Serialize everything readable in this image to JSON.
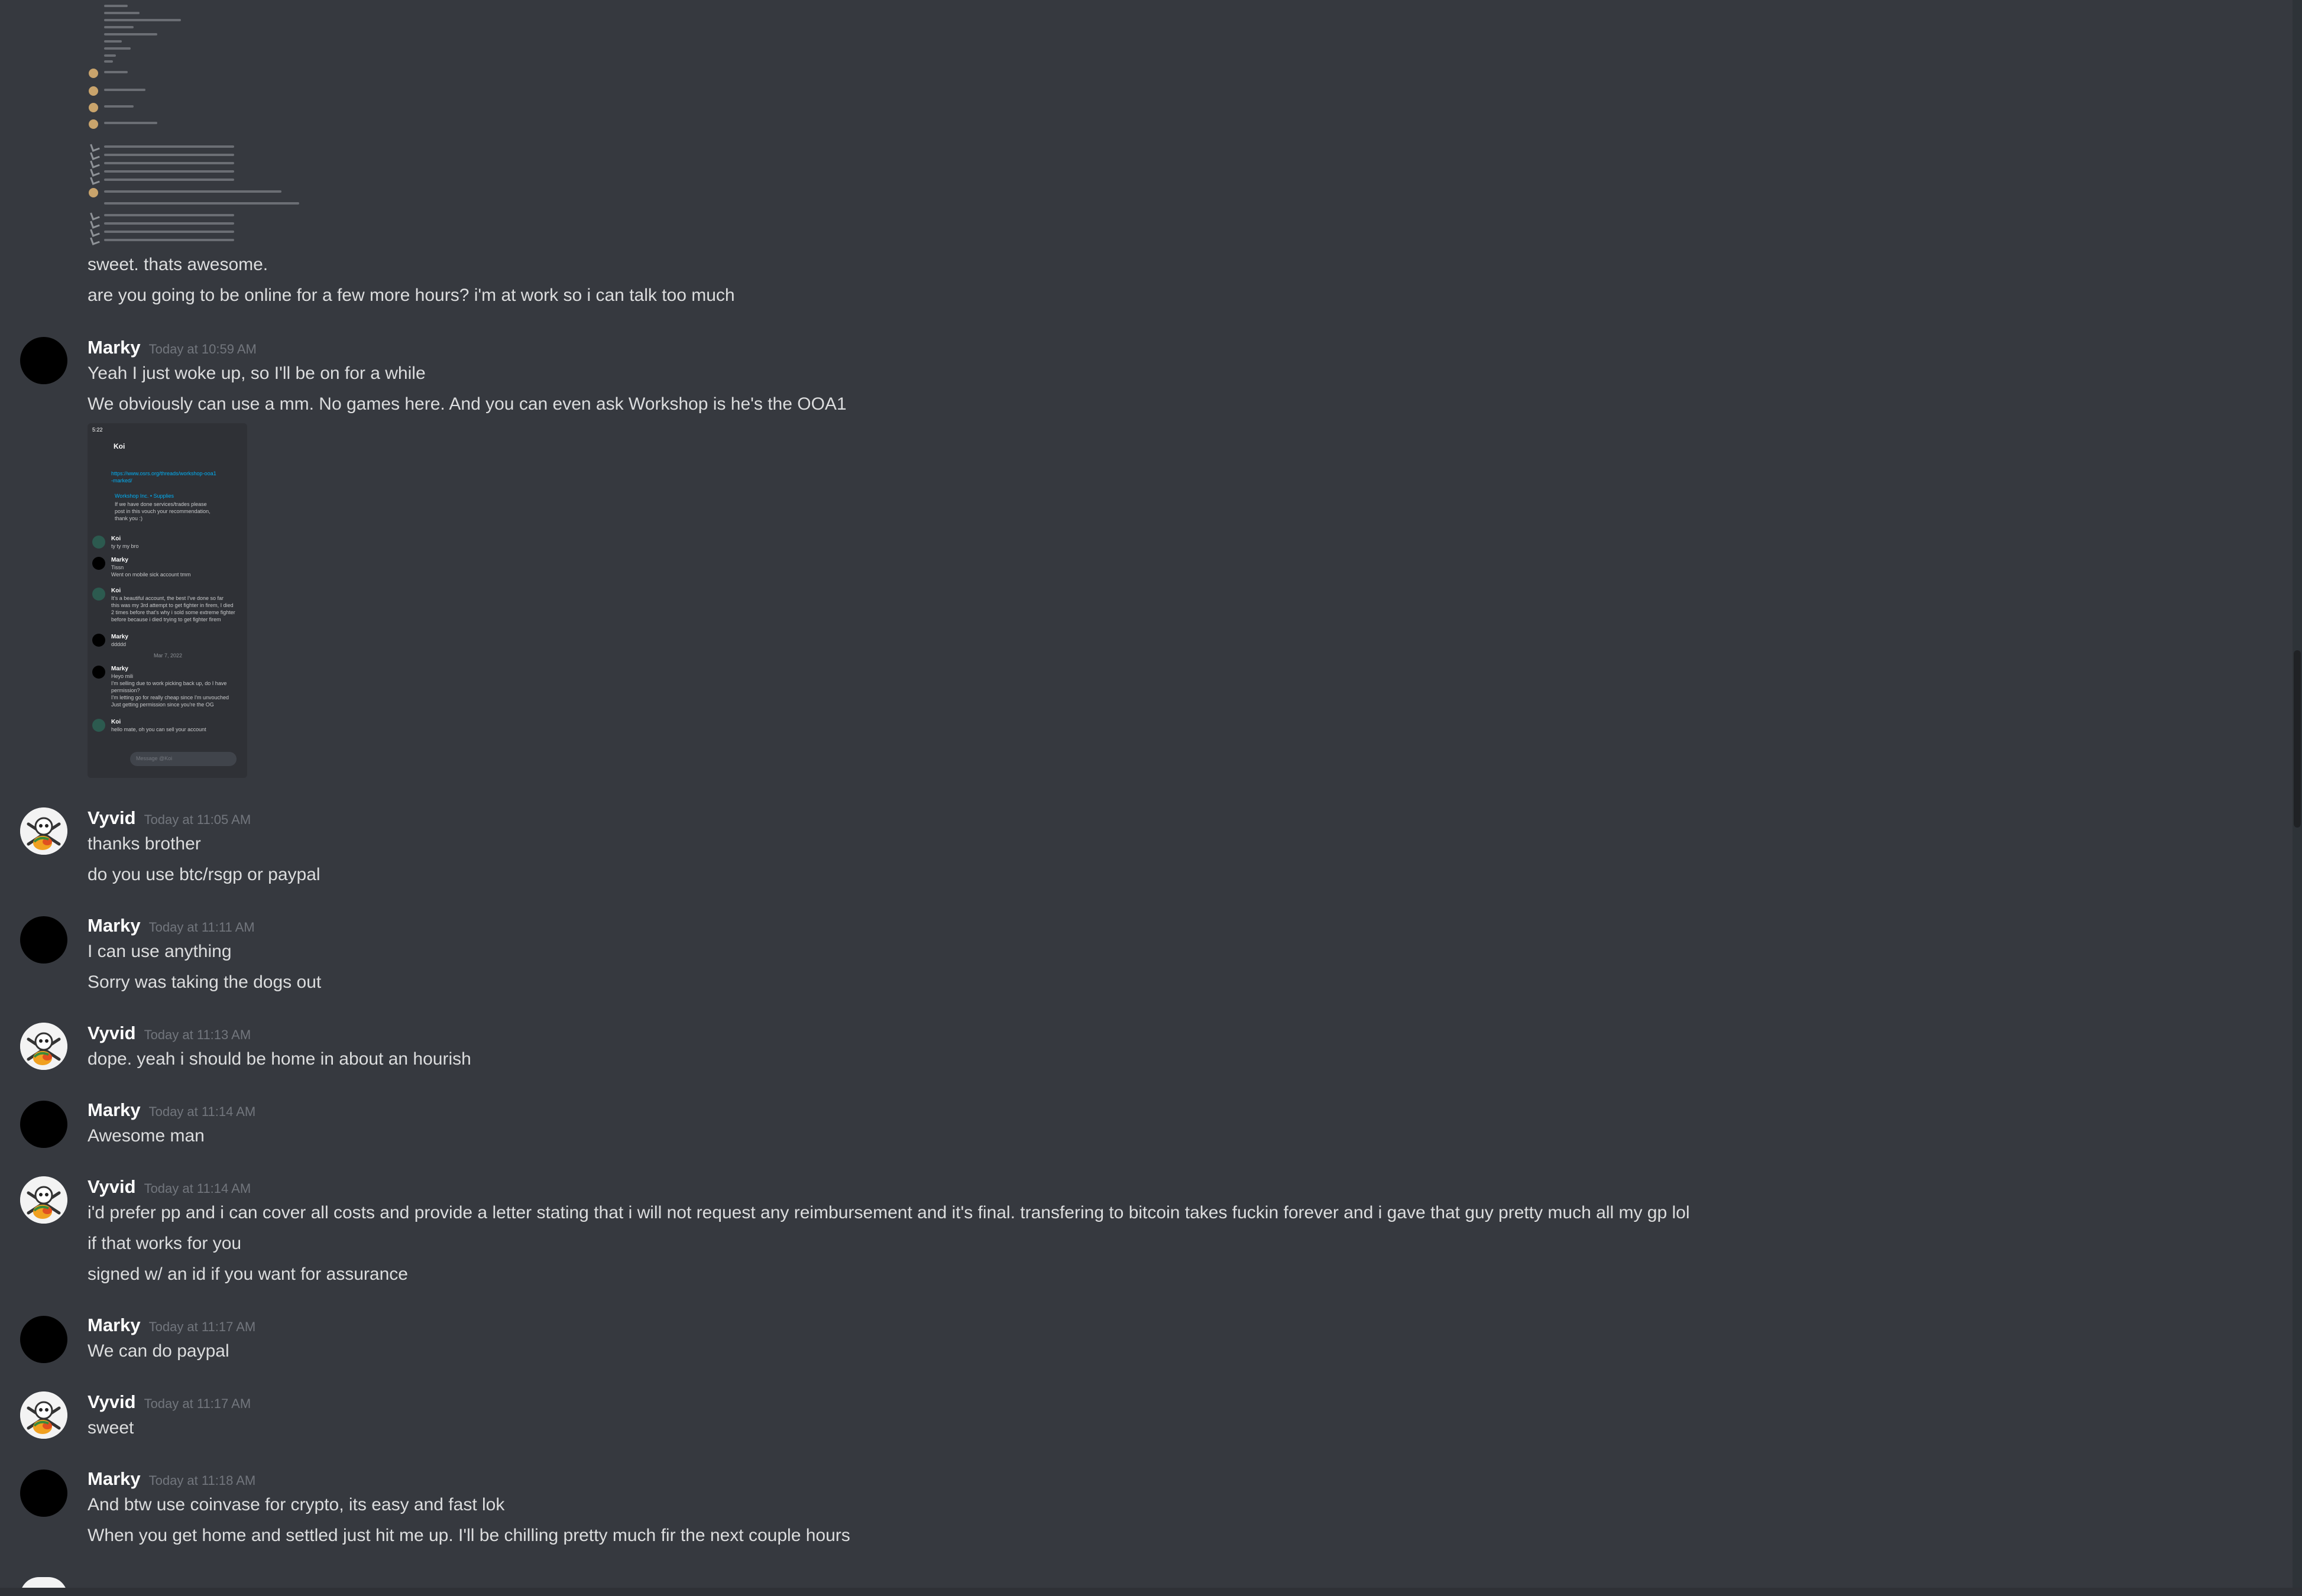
{
  "top_messages": {
    "line1": "sweet. thats awesome.",
    "line2": "are you going to be online for a few more hours? i'm at work so i can talk too much"
  },
  "messages": [
    {
      "author": "Marky",
      "timestamp": "Today at 10:59 AM",
      "lines": [
        "Yeah I just woke up, so I'll be on for a while",
        "We obviously can use a mm. No games here. And you can even ask Workshop is he's the OOA1"
      ]
    },
    {
      "author": "Vyvid",
      "timestamp": "Today at 11:05 AM",
      "lines": [
        "thanks brother",
        "do you use btc/rsgp or paypal"
      ]
    },
    {
      "author": "Marky",
      "timestamp": "Today at 11:11 AM",
      "lines": [
        "I can use anything",
        "Sorry was taking the dogs out"
      ]
    },
    {
      "author": "Vyvid",
      "timestamp": "Today at 11:13 AM",
      "lines": [
        "dope. yeah i should be home in about an hourish"
      ]
    },
    {
      "author": "Marky",
      "timestamp": "Today at 11:14 AM",
      "lines": [
        "Awesome man"
      ]
    },
    {
      "author": "Vyvid",
      "timestamp": "Today at 11:14 AM",
      "lines": [
        "i'd prefer pp and i can cover all costs and provide a letter stating that i will not request any reimbursement and it's final. transfering to bitcoin takes fuckin forever and i gave that guy pretty much all my gp lol",
        "if that works for you",
        "signed w/ an id if you want for assurance"
      ]
    },
    {
      "author": "Marky",
      "timestamp": "Today at 11:17 AM",
      "lines": [
        "We can do paypal"
      ]
    },
    {
      "author": "Vyvid",
      "timestamp": "Today at 11:17 AM",
      "lines": [
        "sweet"
      ]
    },
    {
      "author": "Marky",
      "timestamp": "Today at 11:18 AM",
      "lines": [
        "And btw use coinvase for crypto, its easy and fast lok",
        "When you get home and settled just hit me up. I'll be chilling pretty much fir the next couple hours"
      ]
    }
  ],
  "embed": {
    "status_time": "5:22",
    "channel": "Koi",
    "link_line1": "https://www.osrs.org/threads/workshop-ooa1",
    "link_line2": "-marked/",
    "embed_title": "Workshop Inc. • Supplies",
    "embed_body1": "If we have done services/trades please",
    "embed_body2": "post in this vouch your recommendation,",
    "embed_body3": "thank you :)",
    "m1_name": "Koi",
    "m1_text": "ty ty my bro",
    "m2_name": "Marky",
    "m2_text1": "Tissn",
    "m2_text2": "Went on mobile sick account tmm",
    "m3_name": "Koi",
    "m3_text1": "It's a beautiful account, the best I've done so far",
    "m3_text2": "this was my 3rd attempt to get fighter in firem, I died",
    "m3_text3": "2 times before that's why i sold some extreme fighter",
    "m3_text4": "before because i died trying to get fighter firem",
    "m4_name": "Marky",
    "m4_text": "ddddd",
    "date_divider": "Mar 7, 2022",
    "m5_name": "Marky",
    "m5_text1": "Heyo mili",
    "m5_text2": "I'm selling due to work picking back up, do I have",
    "m5_text3": "permission?",
    "m5_text4": "I'm letting go for really cheap since I'm unvouched",
    "m5_text5": "Just getting permission since you're the OG",
    "m6_name": "Koi",
    "m6_text": "hello mate, oh you can sell your account",
    "input_placeholder": "Message @Koi"
  },
  "colors": {
    "background": "#36393f",
    "text": "#dcddde",
    "author": "#ffffff",
    "timestamp": "#72767d"
  }
}
